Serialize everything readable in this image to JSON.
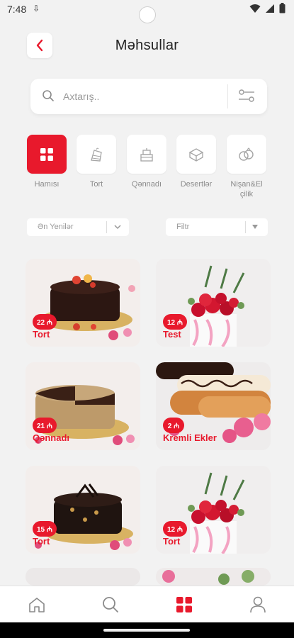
{
  "status_bar": {
    "time": "7:48"
  },
  "header": {
    "title": "Məhsullar"
  },
  "search": {
    "placeholder": "Axtarış.."
  },
  "categories": [
    {
      "label": "Hamısı",
      "icon": "grid-icon",
      "active": true
    },
    {
      "label": "Tort",
      "icon": "cake-slice-icon",
      "active": false
    },
    {
      "label": "Qənnadı",
      "icon": "layer-cake-icon",
      "active": false
    },
    {
      "label": "Desertlər",
      "icon": "dessert-box-icon",
      "active": false
    },
    {
      "label": "Nişan&El çilik",
      "icon": "rings-icon",
      "active": false
    }
  ],
  "filters": {
    "sort_label": "Ən Yenilər",
    "filter_label": "Filtr"
  },
  "products": [
    {
      "price": "22 ₼",
      "name": "Tort"
    },
    {
      "price": "12 ₼",
      "name": "Test"
    },
    {
      "price": "21 ₼",
      "name": "Qənnadı"
    },
    {
      "price": "2 ₼",
      "name": "Kremli Ekler"
    },
    {
      "price": "15 ₼",
      "name": "Tort"
    },
    {
      "price": "12 ₼",
      "name": "Tort"
    }
  ],
  "bottom_nav": [
    {
      "icon": "home-icon",
      "active": false
    },
    {
      "icon": "search-icon",
      "active": false
    },
    {
      "icon": "grid-icon",
      "active": true
    },
    {
      "icon": "profile-icon",
      "active": false
    }
  ],
  "colors": {
    "accent": "#e8192c",
    "background": "#f2f2f2"
  }
}
